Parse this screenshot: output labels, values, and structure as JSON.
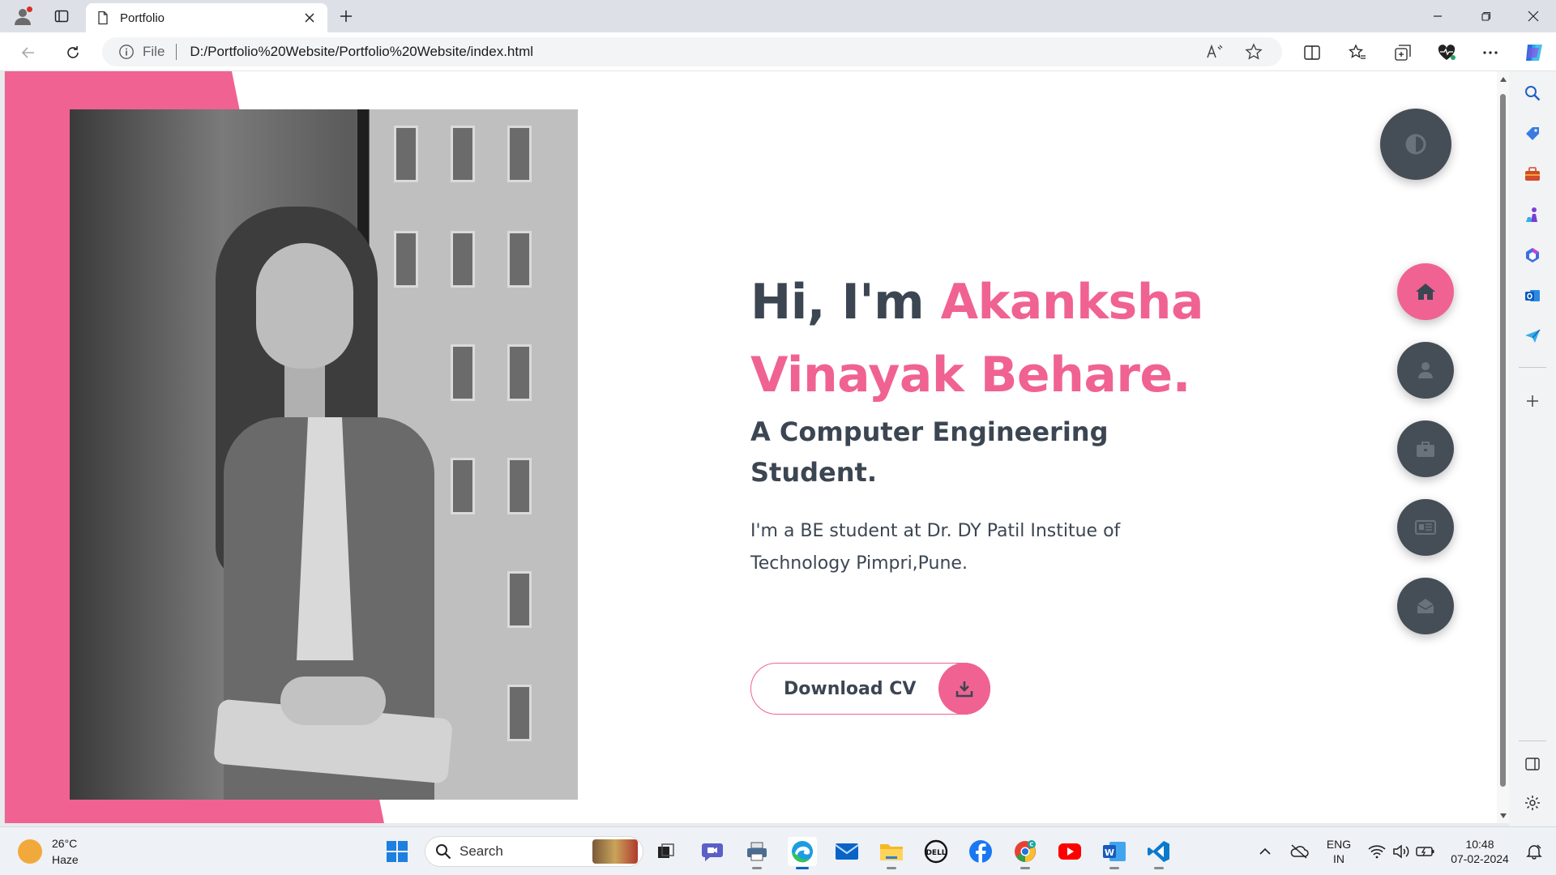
{
  "browser": {
    "tab_title": "Portfolio",
    "address_scheme": "File",
    "address_url": "D:/Portfolio%20Website/Portfolio%20Website/index.html"
  },
  "page": {
    "hero_greeting": "Hi, I'm ",
    "hero_name_line1": "Akanksha",
    "hero_name_line2": "Vinayak Behare.",
    "hero_subtitle": "A Computer Engineering Student.",
    "hero_description": "I'm a BE student at Dr. DY Patil Institue of Technology Pimpri,Pune.",
    "download_label": "Download CV",
    "accent_color": "#f06292",
    "dark_color": "#454e56",
    "nav_items": [
      {
        "icon": "home-icon",
        "active": true
      },
      {
        "icon": "user-icon",
        "active": false
      },
      {
        "icon": "briefcase-icon",
        "active": false
      },
      {
        "icon": "newspaper-icon",
        "active": false
      },
      {
        "icon": "envelope-icon",
        "active": false
      }
    ]
  },
  "taskbar": {
    "weather_temp": "26°C",
    "weather_desc": "Haze",
    "search_label": "Search",
    "lang_line1": "ENG",
    "lang_line2": "IN",
    "time": "10:48",
    "date": "07-02-2024"
  }
}
